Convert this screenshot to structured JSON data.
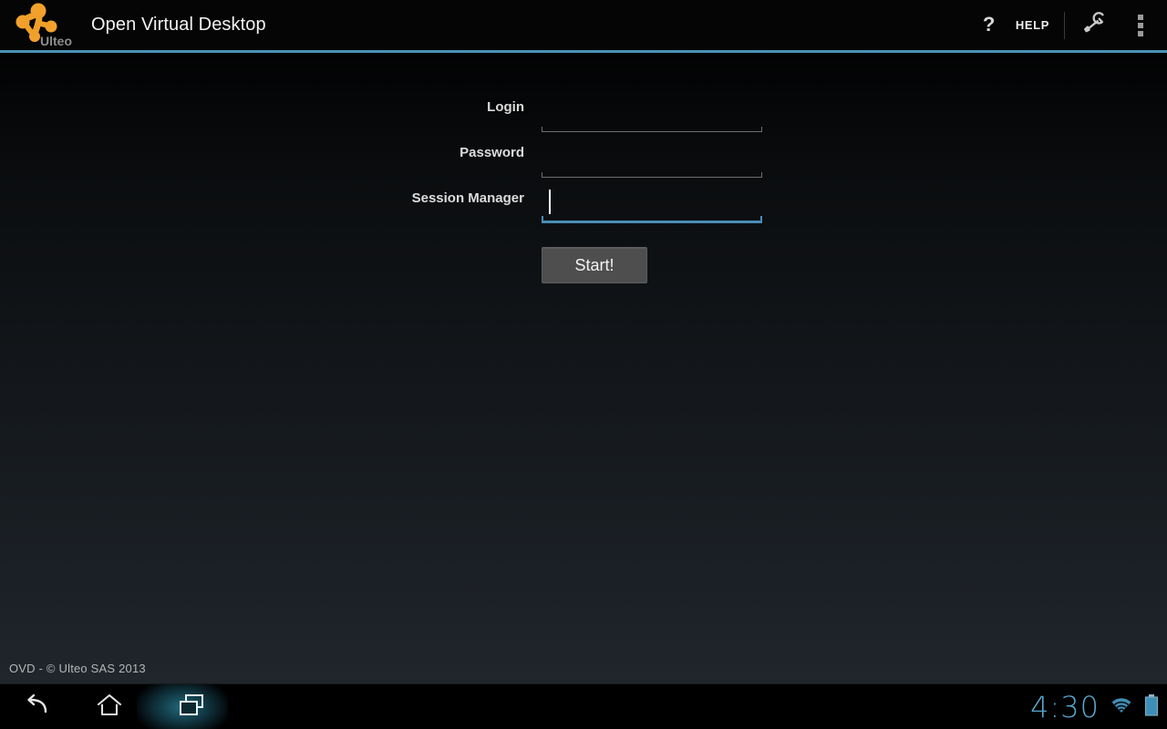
{
  "header": {
    "logo_name": "ulteo-logo",
    "logo_wordmark": "Ulteo",
    "title": "Open Virtual Desktop",
    "help_icon": "question-mark-icon",
    "help_label": "HELP",
    "settings_icon": "wrench-icon",
    "overflow_icon": "overflow-menu-icon",
    "accent_color": "#4a91b5"
  },
  "form": {
    "fields": [
      {
        "label": "Login",
        "value": "",
        "placeholder": "",
        "type": "text",
        "focused": false
      },
      {
        "label": "Password",
        "value": "",
        "placeholder": "",
        "type": "password",
        "focused": false
      },
      {
        "label": "Session Manager",
        "value": "",
        "placeholder": "",
        "type": "text",
        "focused": true
      }
    ],
    "submit_label": "Start!"
  },
  "footer": {
    "copyright": "OVD  - © Ulteo SAS 2013"
  },
  "navbar": {
    "back_icon": "back-arrow-icon",
    "home_icon": "home-icon",
    "recents_icon": "recent-apps-icon",
    "clock": "4:30",
    "wifi_icon": "wifi-icon",
    "battery_icon": "battery-icon",
    "accent_color": "#5aa6cc"
  }
}
